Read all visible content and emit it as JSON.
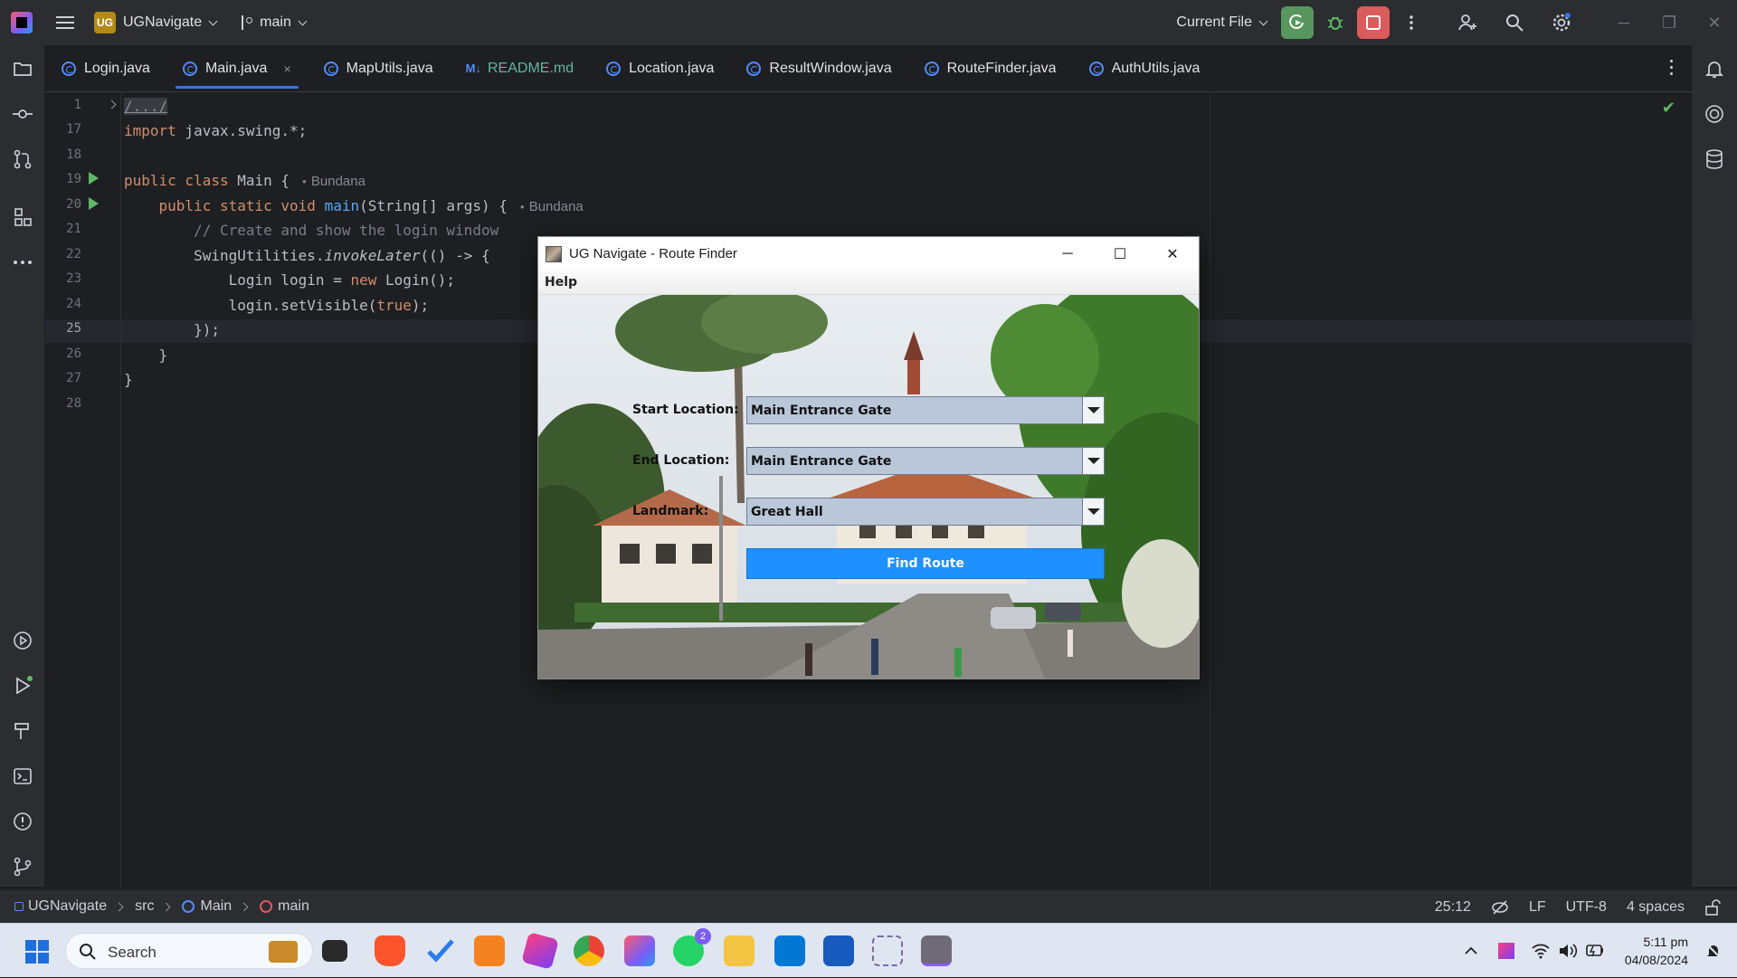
{
  "titlebar": {
    "project_badge": "UG",
    "project_name": "UGNavigate",
    "branch": "main",
    "run_config": "Current File"
  },
  "tabs": [
    {
      "label": "Login.java"
    },
    {
      "label": "Main.java",
      "close": "×"
    },
    {
      "label": "MapUtils.java"
    },
    {
      "label": "README.md",
      "badge": "M↓"
    },
    {
      "label": "Location.java"
    },
    {
      "label": "ResultWindow.java"
    },
    {
      "label": "RouteFinder.java"
    },
    {
      "label": "AuthUtils.java"
    }
  ],
  "editor": {
    "line_numbers": [
      "1",
      "17",
      "18",
      "19",
      "20",
      "21",
      "22",
      "23",
      "24",
      "25",
      "26",
      "27",
      "28"
    ],
    "current_line": "25",
    "lines": {
      "l1": "/.../",
      "l17_kw": "import",
      "l17_rest": " javax.swing.*;",
      "l19_kw": "public class",
      "l19_rest": " Main {",
      "l19_author": "Bundana",
      "l20_kw": "public static void",
      "l20_fn": "main",
      "l20_rest": "(String[] args) {",
      "l20_author": "Bundana",
      "l21": "// Create and show the login window",
      "l22_a": "SwingUtilities.",
      "l22_b": "invokeLater",
      "l22_c": "(() -> {",
      "l23_a": "Login login = ",
      "l23_kw": "new",
      "l23_b": " Login();",
      "l24_a": "login.setVisible(",
      "l24_kw": "true",
      "l24_b": ");",
      "l25": "});",
      "l26": "}",
      "l27": "}"
    }
  },
  "statusbar": {
    "crumbs": [
      "UGNavigate",
      "src",
      "Main",
      "main"
    ],
    "position": "25:12",
    "line_sep": "LF",
    "encoding": "UTF-8",
    "indent": "4 spaces"
  },
  "swing_window": {
    "title": "UG Navigate - Route Finder",
    "menu": "Help",
    "start_label": "Start Location:",
    "start_value": "Main Entrance Gate",
    "end_label": "End Location:",
    "end_value": "Main Entrance Gate",
    "landmark_label": "Landmark:",
    "landmark_value": "Great Hall",
    "button": "Find Route"
  },
  "taskbar": {
    "search_label": "Search",
    "whatsapp_badge": "2",
    "time": "5:11 pm",
    "date": "04/08/2024"
  },
  "colors": {
    "ide_bg": "#1e1f22",
    "accent": "#3574f0",
    "run_green": "#57965c",
    "stop_red": "#db5c5c",
    "button_blue": "#1e90ff"
  }
}
